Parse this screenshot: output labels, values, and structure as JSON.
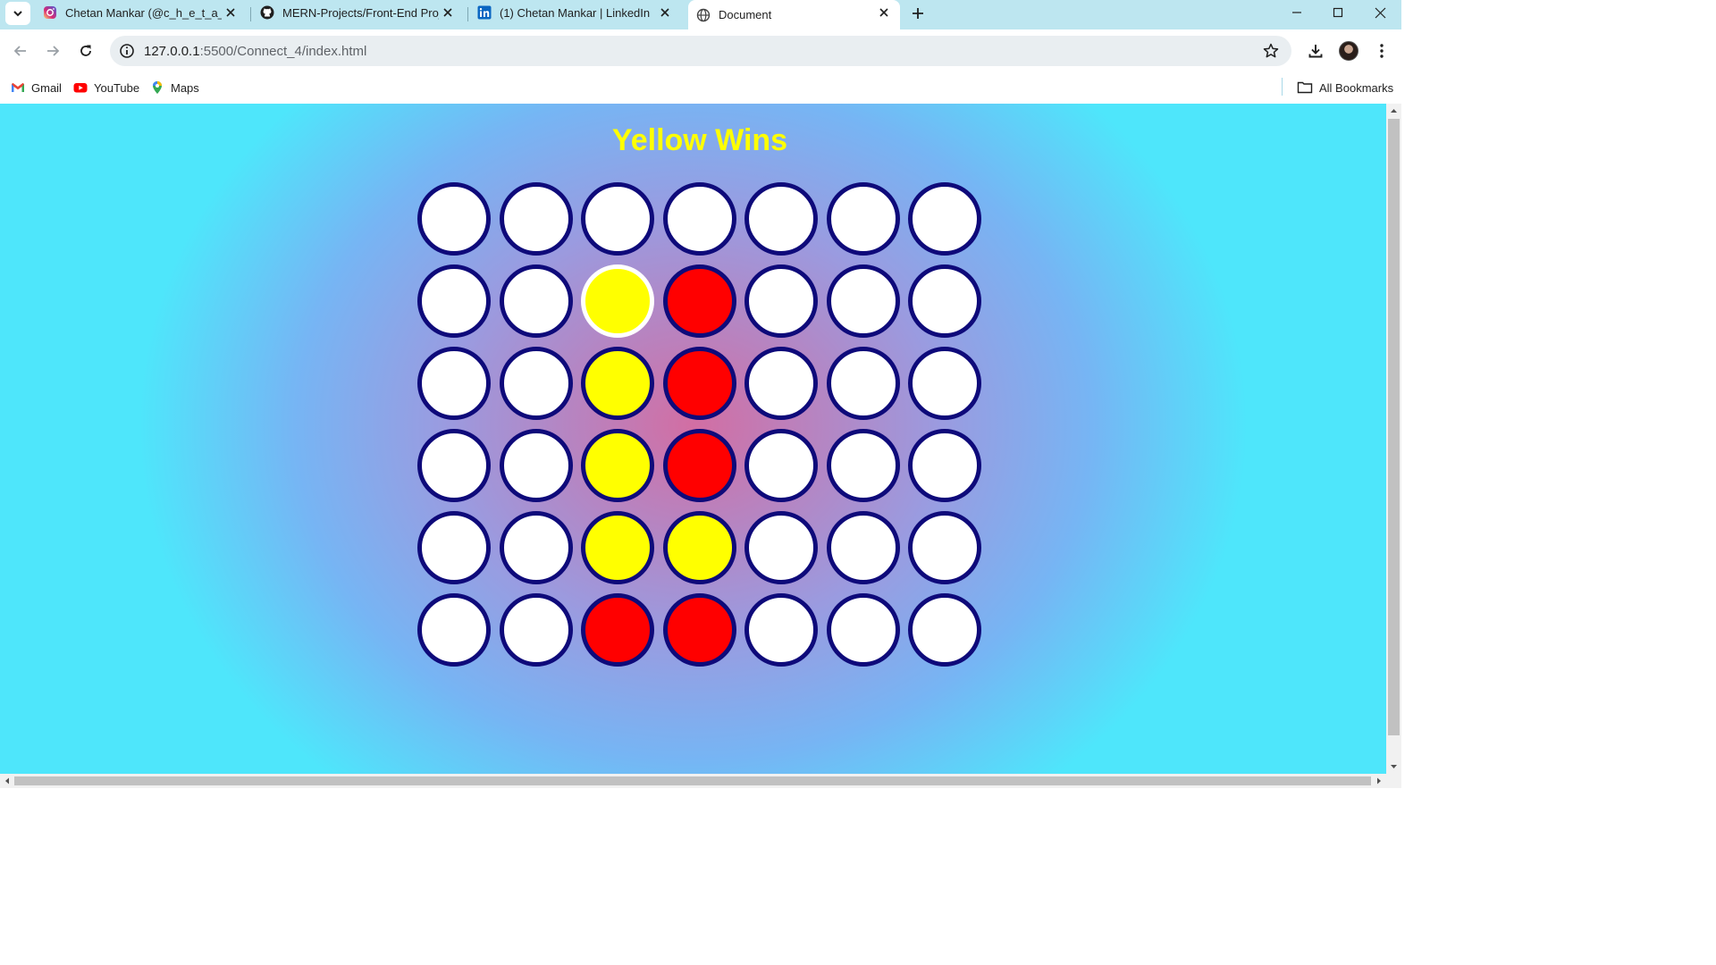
{
  "browser": {
    "tabs": [
      {
        "title": "Chetan Mankar (@c_h_e_t_a_n_",
        "icon": "instagram-icon",
        "active": false
      },
      {
        "title": "MERN-Projects/Front-End Proje",
        "icon": "github-icon",
        "active": false
      },
      {
        "title": "(1) Chetan Mankar | LinkedIn",
        "icon": "linkedin-icon",
        "active": false
      },
      {
        "title": "Document",
        "icon": "globe-icon",
        "active": true
      }
    ],
    "url_host": "127.0.0.1",
    "url_rest": ":5500/Connect_4/index.html",
    "bookmarks": [
      {
        "label": "Gmail",
        "icon": "gmail-icon"
      },
      {
        "label": "YouTube",
        "icon": "youtube-icon"
      },
      {
        "label": "Maps",
        "icon": "maps-icon"
      }
    ],
    "all_bookmarks_label": "All Bookmarks"
  },
  "game": {
    "status": "Yellow Wins",
    "status_color": "#ffff00",
    "board_border_color": "#0e0a7a",
    "piece_colors": {
      "red": "#ff0000",
      "yellow": "#ffff00",
      "empty": "#ffffff"
    },
    "rows": 6,
    "cols": 7,
    "board": [
      [
        "empty",
        "empty",
        "empty",
        "empty",
        "empty",
        "empty",
        "empty"
      ],
      [
        "empty",
        "empty",
        "yellow",
        "red",
        "empty",
        "empty",
        "empty"
      ],
      [
        "empty",
        "empty",
        "yellow",
        "red",
        "empty",
        "empty",
        "empty"
      ],
      [
        "empty",
        "empty",
        "yellow",
        "red",
        "empty",
        "empty",
        "empty"
      ],
      [
        "empty",
        "empty",
        "yellow",
        "yellow",
        "empty",
        "empty",
        "empty"
      ],
      [
        "empty",
        "empty",
        "red",
        "red",
        "empty",
        "empty",
        "empty"
      ]
    ],
    "last_move": {
      "row": 1,
      "col": 2
    }
  }
}
